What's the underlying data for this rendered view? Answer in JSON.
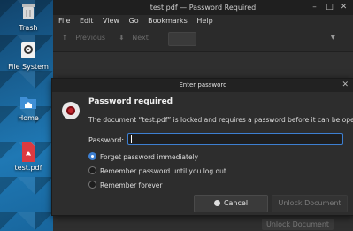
{
  "desktop": {
    "icons": [
      {
        "label": "Trash",
        "icon": "trash-icon"
      },
      {
        "label": "File System",
        "icon": "drive-icon"
      },
      {
        "label": "Home",
        "icon": "home-folder-icon"
      },
      {
        "label": "test.pdf",
        "icon": "pdf-file-icon"
      }
    ]
  },
  "window": {
    "title": "test.pdf — Password Required",
    "controls": {
      "minimize": "–",
      "maximize": "□",
      "close": "✕"
    },
    "menu": [
      "File",
      "Edit",
      "View",
      "Go",
      "Bookmarks",
      "Help"
    ],
    "toolbar": {
      "previous": "Previous",
      "next": "Next",
      "previous_glyph": "⬆",
      "next_glyph": "⬇",
      "menu_glyph": "▼"
    },
    "behind_button": "Unlock Document"
  },
  "dialog": {
    "title": "Enter password",
    "close_glyph": "✕",
    "heading": "Password required",
    "message": "The document “test.pdf” is locked and requires a password before it can be opened.",
    "password_label": "Password:",
    "password_value": "",
    "options": [
      {
        "label": "Forget password immediately",
        "selected": true
      },
      {
        "label": "Remember password until you log out",
        "selected": false
      },
      {
        "label": "Remember forever",
        "selected": false
      }
    ],
    "cancel_label": "Cancel",
    "unlock_label": "Unlock Document"
  },
  "colors": {
    "accent": "#3d7fd1",
    "lock_red": "#c0262d",
    "pdf_red": "#d9262c"
  }
}
